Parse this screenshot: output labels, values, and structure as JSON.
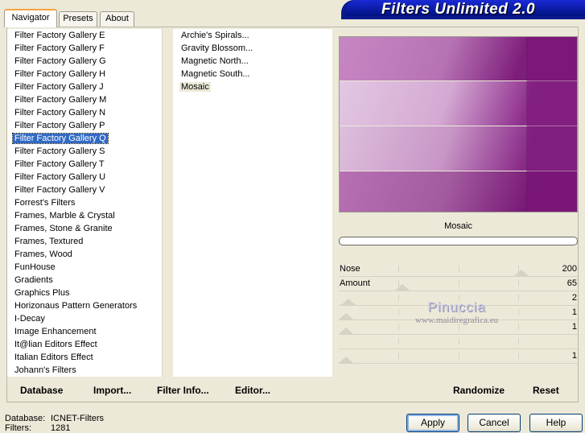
{
  "tabs": [
    "Navigator",
    "Presets",
    "About"
  ],
  "title": "Filters Unlimited 2.0",
  "categories": [
    "Filter Factory Gallery E",
    "Filter Factory Gallery F",
    "Filter Factory Gallery G",
    "Filter Factory Gallery H",
    "Filter Factory Gallery J",
    "Filter Factory Gallery M",
    "Filter Factory Gallery N",
    "Filter Factory Gallery P",
    "Filter Factory Gallery Q",
    "Filter Factory Gallery S",
    "Filter Factory Gallery T",
    "Filter Factory Gallery U",
    "Filter Factory Gallery V",
    "Forrest's Filters",
    "Frames, Marble & Crystal",
    "Frames, Stone & Granite",
    "Frames, Textured",
    "Frames, Wood",
    "FunHouse",
    "Gradients",
    "Graphics Plus",
    "Horizonaus Pattern Generators",
    "I-Decay",
    "Image Enhancement",
    "It@lian Editors Effect",
    "Italian Editors Effect",
    "Johann's Filters"
  ],
  "selected_category": "Filter Factory Gallery Q",
  "filters": [
    "Archie's Spirals...",
    "Gravity Blossom...",
    "Magnetic North...",
    "Magnetic South...",
    "Mosaic"
  ],
  "selected_filter": "Mosaic",
  "filter_name": "Mosaic",
  "progress": 0,
  "sliders": [
    {
      "label": "Nose",
      "value": "200",
      "level": 0.78
    },
    {
      "label": "Amount",
      "value": "65",
      "level": 0.25
    },
    {
      "label": "",
      "value": "2",
      "level": 0.01
    },
    {
      "label": "",
      "value": "1",
      "level": 0.0
    },
    {
      "label": "",
      "value": "1",
      "level": 0.0
    },
    {
      "label": "",
      "value": "",
      "level": null
    },
    {
      "label": "",
      "value": "1",
      "level": 0.0
    }
  ],
  "watermark": {
    "name": "Pinuccia",
    "site": "www.maidiregrafica.eu"
  },
  "toolbar": {
    "database": "Database",
    "import": "Import...",
    "filter_info": "Filter Info...",
    "editor": "Editor...",
    "randomize": "Randomize",
    "reset": "Reset"
  },
  "info": {
    "database_label": "Database:",
    "database_value": "ICNET-Filters",
    "filters_label": "Filters:",
    "filters_value": "1281"
  },
  "buttons": {
    "apply": "Apply",
    "cancel": "Cancel",
    "help": "Help"
  }
}
